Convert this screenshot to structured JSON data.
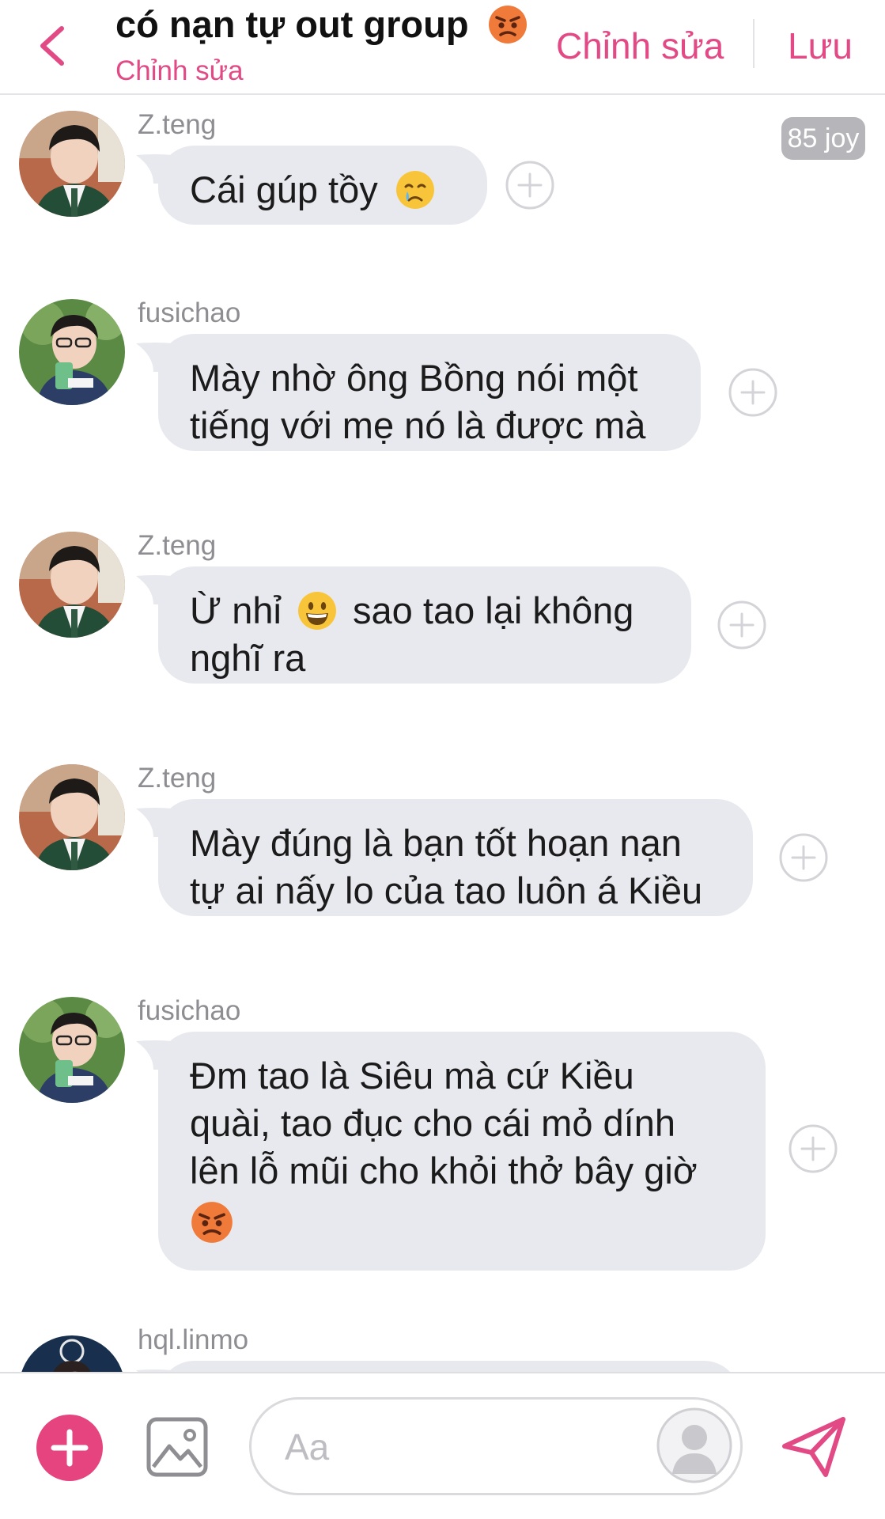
{
  "header": {
    "title": "có nạn tự out group",
    "subtitle": "Chỉnh sửa",
    "edit_label": "Chỉnh sửa",
    "save_label": "Lưu"
  },
  "badge": "85 joy",
  "messages": [
    {
      "sender": "Z.teng",
      "text": "Cái gúp tồy",
      "emoji": "crying-face"
    },
    {
      "sender": "fusichao",
      "lines": [
        "Mày nhờ ông Bồng nói một",
        "tiếng với mẹ nó là được mà"
      ]
    },
    {
      "sender": "Z.teng",
      "line1a": "Ừ nhỉ",
      "line1b": "sao tao lại không",
      "line2": "nghĩ ra",
      "emoji": "grinning-face"
    },
    {
      "sender": "Z.teng",
      "lines": [
        "Mày đúng là bạn tốt hoạn nạn",
        "tự ai nấy lo của tao luôn á Kiều"
      ]
    },
    {
      "sender": "fusichao",
      "lines": [
        "Đm tao là Siêu mà cứ Kiều",
        "quài, tao đục cho cái mỏ dính",
        "lên lỗ mũi cho khỏi thở bây giờ"
      ],
      "emoji": "angry-face"
    },
    {
      "sender": "hql.linmo"
    }
  ],
  "composer": {
    "placeholder": "Aa"
  },
  "colors": {
    "accent": "#e24a86",
    "bubble": "#e8e9ee",
    "muted": "#8d8d92"
  }
}
